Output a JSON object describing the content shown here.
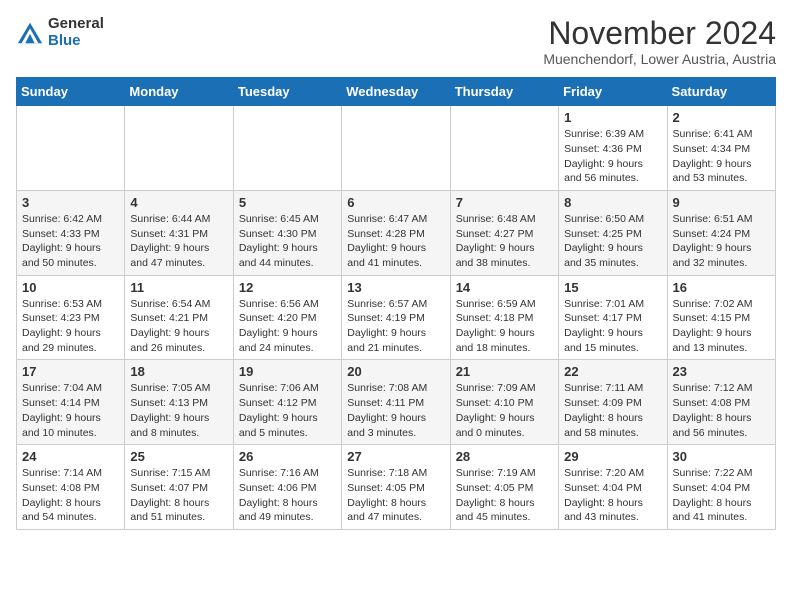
{
  "logo": {
    "general": "General",
    "blue": "Blue"
  },
  "title": "November 2024",
  "subtitle": "Muenchendorf, Lower Austria, Austria",
  "weekdays": [
    "Sunday",
    "Monday",
    "Tuesday",
    "Wednesday",
    "Thursday",
    "Friday",
    "Saturday"
  ],
  "weeks": [
    [
      {
        "day": "",
        "info": ""
      },
      {
        "day": "",
        "info": ""
      },
      {
        "day": "",
        "info": ""
      },
      {
        "day": "",
        "info": ""
      },
      {
        "day": "",
        "info": ""
      },
      {
        "day": "1",
        "info": "Sunrise: 6:39 AM\nSunset: 4:36 PM\nDaylight: 9 hours\nand 56 minutes."
      },
      {
        "day": "2",
        "info": "Sunrise: 6:41 AM\nSunset: 4:34 PM\nDaylight: 9 hours\nand 53 minutes."
      }
    ],
    [
      {
        "day": "3",
        "info": "Sunrise: 6:42 AM\nSunset: 4:33 PM\nDaylight: 9 hours\nand 50 minutes."
      },
      {
        "day": "4",
        "info": "Sunrise: 6:44 AM\nSunset: 4:31 PM\nDaylight: 9 hours\nand 47 minutes."
      },
      {
        "day": "5",
        "info": "Sunrise: 6:45 AM\nSunset: 4:30 PM\nDaylight: 9 hours\nand 44 minutes."
      },
      {
        "day": "6",
        "info": "Sunrise: 6:47 AM\nSunset: 4:28 PM\nDaylight: 9 hours\nand 41 minutes."
      },
      {
        "day": "7",
        "info": "Sunrise: 6:48 AM\nSunset: 4:27 PM\nDaylight: 9 hours\nand 38 minutes."
      },
      {
        "day": "8",
        "info": "Sunrise: 6:50 AM\nSunset: 4:25 PM\nDaylight: 9 hours\nand 35 minutes."
      },
      {
        "day": "9",
        "info": "Sunrise: 6:51 AM\nSunset: 4:24 PM\nDaylight: 9 hours\nand 32 minutes."
      }
    ],
    [
      {
        "day": "10",
        "info": "Sunrise: 6:53 AM\nSunset: 4:23 PM\nDaylight: 9 hours\nand 29 minutes."
      },
      {
        "day": "11",
        "info": "Sunrise: 6:54 AM\nSunset: 4:21 PM\nDaylight: 9 hours\nand 26 minutes."
      },
      {
        "day": "12",
        "info": "Sunrise: 6:56 AM\nSunset: 4:20 PM\nDaylight: 9 hours\nand 24 minutes."
      },
      {
        "day": "13",
        "info": "Sunrise: 6:57 AM\nSunset: 4:19 PM\nDaylight: 9 hours\nand 21 minutes."
      },
      {
        "day": "14",
        "info": "Sunrise: 6:59 AM\nSunset: 4:18 PM\nDaylight: 9 hours\nand 18 minutes."
      },
      {
        "day": "15",
        "info": "Sunrise: 7:01 AM\nSunset: 4:17 PM\nDaylight: 9 hours\nand 15 minutes."
      },
      {
        "day": "16",
        "info": "Sunrise: 7:02 AM\nSunset: 4:15 PM\nDaylight: 9 hours\nand 13 minutes."
      }
    ],
    [
      {
        "day": "17",
        "info": "Sunrise: 7:04 AM\nSunset: 4:14 PM\nDaylight: 9 hours\nand 10 minutes."
      },
      {
        "day": "18",
        "info": "Sunrise: 7:05 AM\nSunset: 4:13 PM\nDaylight: 9 hours\nand 8 minutes."
      },
      {
        "day": "19",
        "info": "Sunrise: 7:06 AM\nSunset: 4:12 PM\nDaylight: 9 hours\nand 5 minutes."
      },
      {
        "day": "20",
        "info": "Sunrise: 7:08 AM\nSunset: 4:11 PM\nDaylight: 9 hours\nand 3 minutes."
      },
      {
        "day": "21",
        "info": "Sunrise: 7:09 AM\nSunset: 4:10 PM\nDaylight: 9 hours\nand 0 minutes."
      },
      {
        "day": "22",
        "info": "Sunrise: 7:11 AM\nSunset: 4:09 PM\nDaylight: 8 hours\nand 58 minutes."
      },
      {
        "day": "23",
        "info": "Sunrise: 7:12 AM\nSunset: 4:08 PM\nDaylight: 8 hours\nand 56 minutes."
      }
    ],
    [
      {
        "day": "24",
        "info": "Sunrise: 7:14 AM\nSunset: 4:08 PM\nDaylight: 8 hours\nand 54 minutes."
      },
      {
        "day": "25",
        "info": "Sunrise: 7:15 AM\nSunset: 4:07 PM\nDaylight: 8 hours\nand 51 minutes."
      },
      {
        "day": "26",
        "info": "Sunrise: 7:16 AM\nSunset: 4:06 PM\nDaylight: 8 hours\nand 49 minutes."
      },
      {
        "day": "27",
        "info": "Sunrise: 7:18 AM\nSunset: 4:05 PM\nDaylight: 8 hours\nand 47 minutes."
      },
      {
        "day": "28",
        "info": "Sunrise: 7:19 AM\nSunset: 4:05 PM\nDaylight: 8 hours\nand 45 minutes."
      },
      {
        "day": "29",
        "info": "Sunrise: 7:20 AM\nSunset: 4:04 PM\nDaylight: 8 hours\nand 43 minutes."
      },
      {
        "day": "30",
        "info": "Sunrise: 7:22 AM\nSunset: 4:04 PM\nDaylight: 8 hours\nand 41 minutes."
      }
    ]
  ]
}
